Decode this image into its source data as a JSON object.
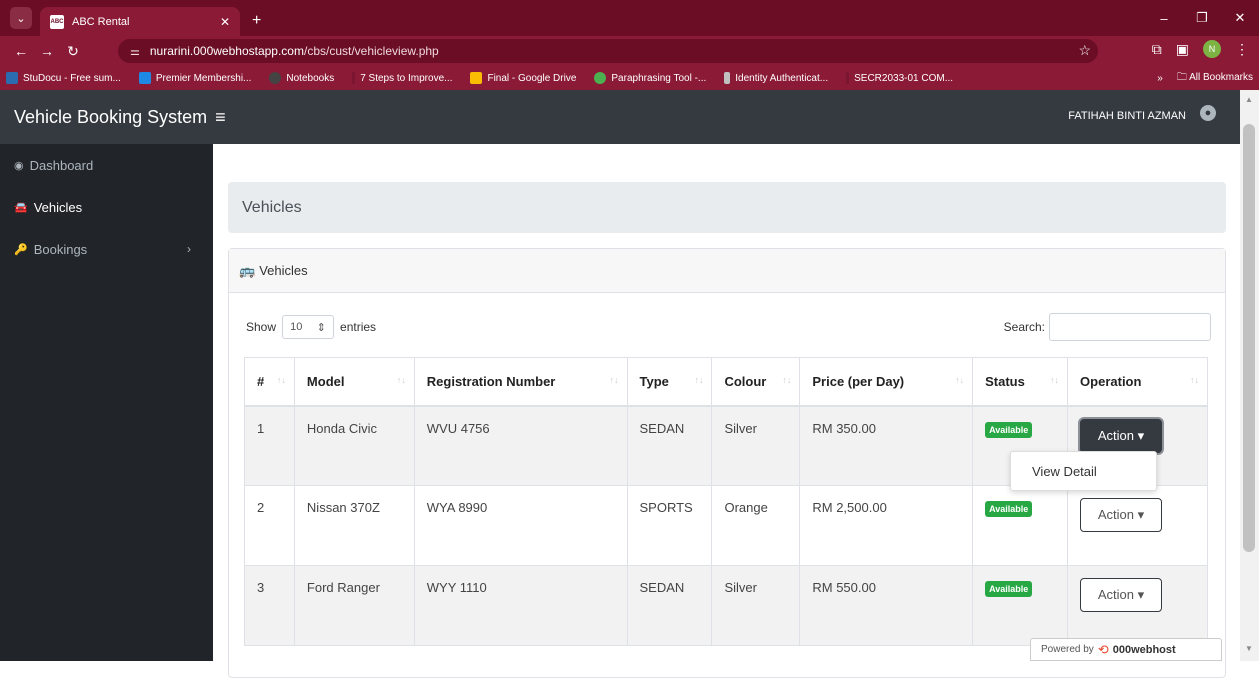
{
  "browser": {
    "tab_title": "ABC Rental",
    "favicon_text": "ABC",
    "url_host": "nurarini.000webhostapp.com",
    "url_path": "/cbs/cust/vehicleview.php",
    "profile_initial": "N",
    "bookmarks": [
      {
        "label": "StuDocu - Free sum...",
        "color": "#2b6cb0"
      },
      {
        "label": "Premier Membershi...",
        "color": "#1e88e5"
      },
      {
        "label": "Notebooks",
        "color": "#444444"
      },
      {
        "label": "7 Steps to Improve...",
        "color": "#7a1630"
      },
      {
        "label": "Final - Google Drive",
        "color": "#fbbc04"
      },
      {
        "label": "Paraphrasing Tool -...",
        "color": "#4caf50"
      },
      {
        "label": "Identity Authenticat...",
        "color": "#c0c0c0"
      },
      {
        "label": "SECR2033-01 COM...",
        "color": "#7a1630"
      }
    ],
    "more_bookmarks": "»",
    "all_bookmarks": "All Bookmarks"
  },
  "app": {
    "brand": "Vehicle Booking System",
    "user": "FATIHAH BINTI AZMAN"
  },
  "sidebar": {
    "items": [
      {
        "label": "Dashboard"
      },
      {
        "label": "Vehicles"
      },
      {
        "label": "Bookings"
      }
    ]
  },
  "page": {
    "title": "Vehicles",
    "card_title": "Vehicles",
    "show_label": "Show",
    "entries_value": "10",
    "entries_label": "entries",
    "search_label": "Search:"
  },
  "table": {
    "headers": [
      "#",
      "Model",
      "Registration Number",
      "Type",
      "Colour",
      "Price (per Day)",
      "Status",
      "Operation"
    ],
    "rows": [
      {
        "num": "1",
        "model": "Honda Civic",
        "reg": "WVU 4756",
        "type": "SEDAN",
        "colour": "Silver",
        "price": "RM 350.00",
        "status": "Available",
        "action": "Action"
      },
      {
        "num": "2",
        "model": "Nissan 370Z",
        "reg": "WYA 8990",
        "type": "SPORTS",
        "colour": "Orange",
        "price": "RM 2,500.00",
        "status": "Available",
        "action": "Action"
      },
      {
        "num": "3",
        "model": "Ford Ranger",
        "reg": "WYY 1110",
        "type": "SEDAN",
        "colour": "Silver",
        "price": "RM 550.00",
        "status": "Available",
        "action": "Action"
      }
    ]
  },
  "dropdown": {
    "item": "View Detail"
  },
  "footer": {
    "powered_by": "Powered by",
    "host": "000webhost"
  }
}
